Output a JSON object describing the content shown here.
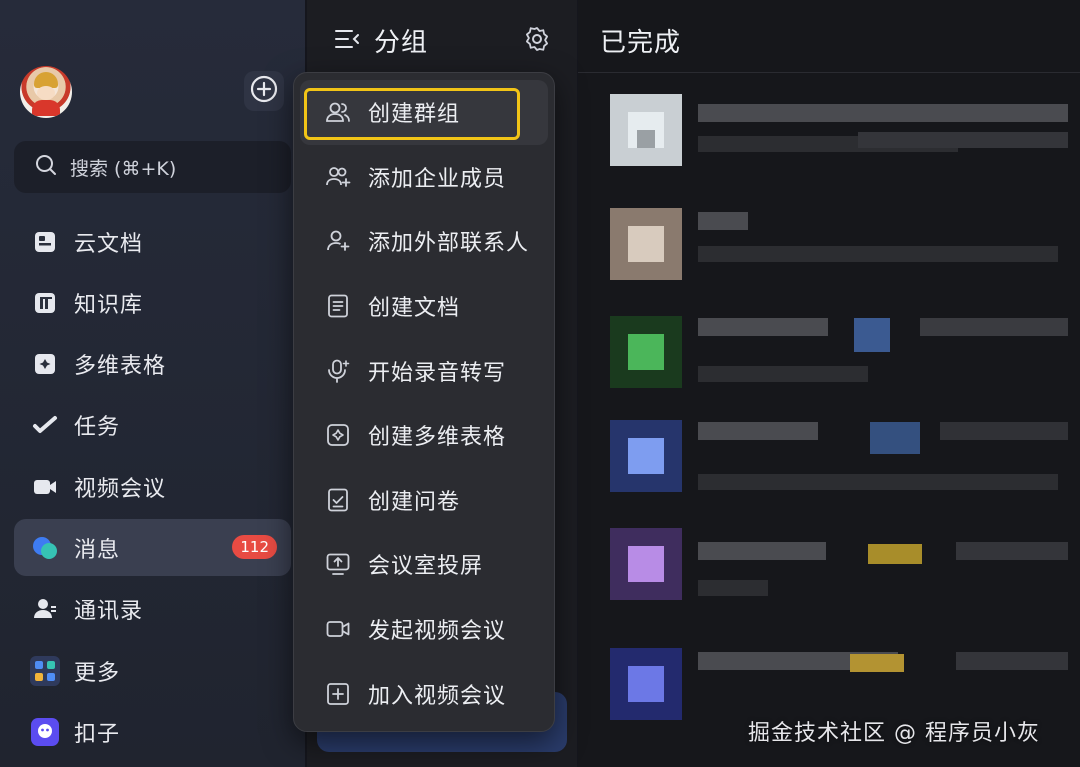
{
  "sidebar": {
    "search_label": "搜索 (⌘+K)",
    "items": [
      {
        "label": "云文档",
        "icon": "cloud-doc-icon"
      },
      {
        "label": "知识库",
        "icon": "wiki-icon"
      },
      {
        "label": "多维表格",
        "icon": "base-icon"
      },
      {
        "label": "任务",
        "icon": "task-icon"
      },
      {
        "label": "视频会议",
        "icon": "video-icon"
      },
      {
        "label": "消息",
        "icon": "message-icon",
        "badge": "112",
        "active": true
      },
      {
        "label": "通讯录",
        "icon": "contacts-icon"
      },
      {
        "label": "更多",
        "icon": "more-apps-icon"
      },
      {
        "label": "扣子",
        "icon": "coze-icon"
      }
    ]
  },
  "groups": {
    "title": "分组"
  },
  "completed": {
    "title": "已完成"
  },
  "menu": {
    "items": [
      {
        "label": "创建群组",
        "icon": "group-icon",
        "highlighted": true
      },
      {
        "label": "添加企业成员",
        "icon": "add-members-icon"
      },
      {
        "label": "添加外部联系人",
        "icon": "add-contact-icon"
      },
      {
        "label": "创建文档",
        "icon": "document-icon"
      },
      {
        "label": "开始录音转写",
        "icon": "microphone-icon"
      },
      {
        "label": "创建多维表格",
        "icon": "base-icon"
      },
      {
        "label": "创建问卷",
        "icon": "survey-icon"
      },
      {
        "label": "会议室投屏",
        "icon": "screen-share-icon"
      },
      {
        "label": "发起视频会议",
        "icon": "video-icon"
      },
      {
        "label": "加入视频会议",
        "icon": "join-meeting-icon"
      }
    ]
  },
  "watermark": "掘金技术社区 @ 程序员小灰",
  "colors": {
    "highlight": "#f2c417",
    "badge": "#e84b43"
  }
}
